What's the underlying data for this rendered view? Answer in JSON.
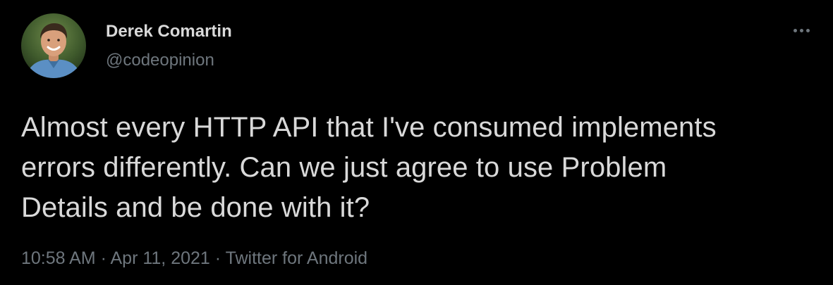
{
  "author": {
    "name": "Derek Comartin",
    "handle": "@codeopinion"
  },
  "tweet": {
    "lines": [
      "Almost every HTTP API that I've consumed implements",
      "errors differently. Can we just agree to use Problem",
      "Details and be done with it?"
    ]
  },
  "meta": {
    "time": "10:58 AM",
    "separator": "·",
    "date": "Apr 11, 2021",
    "source": "Twitter for Android"
  },
  "icons": {
    "more": "more-horizontal-icon"
  },
  "colors": {
    "background": "#000000",
    "primary_text": "#d9d9d9",
    "secondary_text": "#6e767d"
  }
}
